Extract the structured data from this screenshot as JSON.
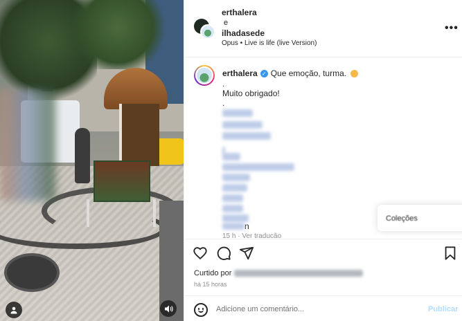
{
  "header": {
    "user1": "erthalera",
    "and": "e",
    "user2": "ilhadasede",
    "music": "Opus • Live is life (live Version)"
  },
  "caption": {
    "user": "erthalera",
    "text": "Que emoção, turma.",
    "dot1": ".",
    "line2": "Muito obrigado!",
    "dot2": ".",
    "tag_end": "n",
    "time": "15 h · Ver tradução"
  },
  "popup": {
    "label": "Coleções"
  },
  "likes": {
    "prefix": "Curtido por"
  },
  "time_ago": "há 15 horas",
  "comment": {
    "placeholder": "Adicione um comentário...",
    "publish": "Publicar"
  },
  "icons": [
    "heart-icon",
    "comment-icon",
    "share-icon",
    "bookmark-icon",
    "more-icon",
    "emoji-icon",
    "user-tag-icon",
    "audio-icon",
    "verified-icon"
  ]
}
